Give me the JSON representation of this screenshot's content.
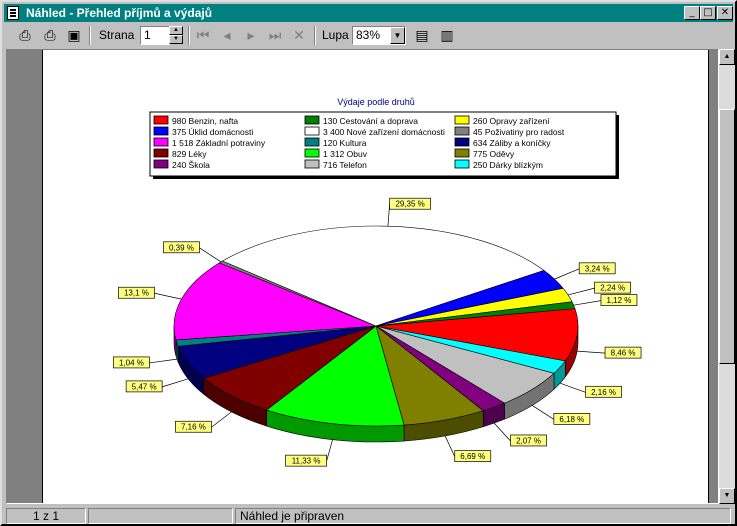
{
  "window": {
    "title": "Náhled - Přehled příjmů a výdajů"
  },
  "toolbar": {
    "page_label": "Strana",
    "page_value": "1",
    "zoom_label": "Lupa",
    "zoom_value": "83%"
  },
  "status": {
    "page_count": "1 z 1",
    "message": "Náhled je připraven"
  },
  "chart_data": {
    "type": "pie",
    "title": "Výdaje podle druhů",
    "legend": [
      {
        "value": "980",
        "name": "Benzin, nafta",
        "color": "#ff0000"
      },
      {
        "value": "375",
        "name": "Úklid domácnosti",
        "color": "#0000ff"
      },
      {
        "value": "1 518",
        "name": "Základní potraviny",
        "color": "#ff00ff"
      },
      {
        "value": "829",
        "name": "Léky",
        "color": "#800000"
      },
      {
        "value": "240",
        "name": "Škola",
        "color": "#800080"
      },
      {
        "value": "130",
        "name": "Cestování a doprava",
        "color": "#008000"
      },
      {
        "value": "3 400",
        "name": "Nové zařízení domácnosti",
        "color": "#ffffff"
      },
      {
        "value": "120",
        "name": "Kultura",
        "color": "#008080"
      },
      {
        "value": "1 312",
        "name": "Obuv",
        "color": "#00ff00"
      },
      {
        "value": "716",
        "name": "Telefon",
        "color": "#c0c0c0"
      },
      {
        "value": "260",
        "name": "Opravy zařízení",
        "color": "#ffff00"
      },
      {
        "value": "45",
        "name": "Poživatiny pro radost",
        "color": "#808080"
      },
      {
        "value": "634",
        "name": "Záliby a koníčky",
        "color": "#000080"
      },
      {
        "value": "775",
        "name": "Oděvy",
        "color": "#808000"
      },
      {
        "value": "250",
        "name": "Dárky blízkým",
        "color": "#00ffff"
      }
    ],
    "slices": [
      {
        "name": "Benzin, nafta",
        "value": 980,
        "pct": "8,46 %",
        "color": "#ff0000"
      },
      {
        "name": "Dárky blízkým",
        "value": 250,
        "pct": "2,16 %",
        "color": "#00ffff"
      },
      {
        "name": "Telefon",
        "value": 716,
        "pct": "6,18 %",
        "color": "#c0c0c0"
      },
      {
        "name": "Škola",
        "value": 240,
        "pct": "2,07 %",
        "color": "#800080"
      },
      {
        "name": "Oděvy",
        "value": 775,
        "pct": "6,69 %",
        "color": "#808000"
      },
      {
        "name": "Obuv",
        "value": 1312,
        "pct": "11,33 %",
        "color": "#00ff00"
      },
      {
        "name": "Léky",
        "value": 829,
        "pct": "7,16 %",
        "color": "#800000"
      },
      {
        "name": "Záliby a koníčky",
        "value": 634,
        "pct": "5,47 %",
        "color": "#000080"
      },
      {
        "name": "Kultura",
        "value": 120,
        "pct": "1,04 %",
        "color": "#008080"
      },
      {
        "name": "Základní potraviny",
        "value": 1518,
        "pct": "13,1 %",
        "color": "#ff00ff"
      },
      {
        "name": "Poživatiny pro radost",
        "value": 45,
        "pct": "0,39 %",
        "color": "#808080"
      },
      {
        "name": "Nové zařízení domácnosti",
        "value": 3400,
        "pct": "29,35 %",
        "color": "#ffffff"
      },
      {
        "name": "Úklid domácnosti",
        "value": 375,
        "pct": "3,24 %",
        "color": "#0000ff"
      },
      {
        "name": "Opravy zařízení",
        "value": 260,
        "pct": "2,24 %",
        "color": "#ffff00"
      },
      {
        "name": "Cestování a doprava",
        "value": 130,
        "pct": "1,12 %",
        "color": "#008000"
      }
    ]
  }
}
